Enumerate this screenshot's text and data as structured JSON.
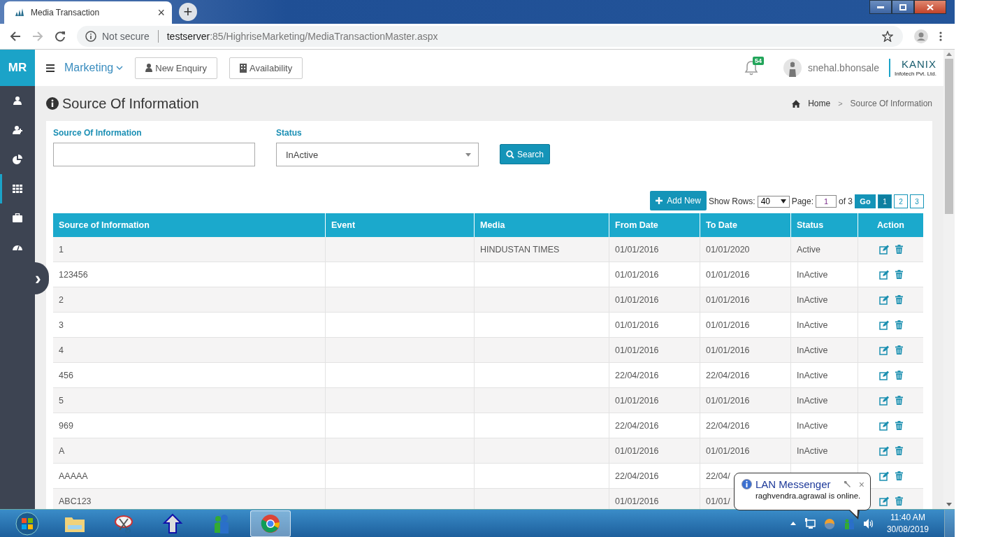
{
  "browser": {
    "tab_title": "Media Transaction",
    "tab_close": "×",
    "new_tab": "+",
    "security": "Not secure",
    "url_host": "testserver",
    "url_path": ":85/HighriseMarketing/MediaTransactionMaster.aspx"
  },
  "sidebar": {
    "logo": "MR",
    "toggle": "›",
    "items": [
      {
        "kind": "user",
        "selected": false
      },
      {
        "kind": "user-plus",
        "selected": false
      },
      {
        "kind": "pie",
        "selected": false
      },
      {
        "kind": "grid",
        "selected": true
      },
      {
        "kind": "briefcase",
        "selected": false
      },
      {
        "kind": "gauge",
        "selected": false
      }
    ]
  },
  "header": {
    "module": "Marketing",
    "buttons": [
      {
        "kind": "user",
        "label": "New Enquiry"
      },
      {
        "kind": "building",
        "label": "Availability"
      }
    ],
    "notifications": "54",
    "user": "snehal.bhonsale",
    "company": "KANIX",
    "company_sub": "Infotech Pvt. Ltd."
  },
  "page": {
    "title": "Source Of Information",
    "breadcrumb": [
      "Home",
      "Source Of Information"
    ],
    "breadcrumb_separator": ">"
  },
  "filters": {
    "source_label": "Source Of Information",
    "status_label": "Status",
    "status_value": "InActive",
    "search_button": "Search"
  },
  "toolbar": {
    "add_button": "Add New",
    "rows_label": "Show Rows:",
    "rows_value": "40",
    "page_label": "Page:",
    "page_value": "1",
    "of_label": "of 3",
    "go_button": "Go",
    "pages": [
      {
        "label": "1",
        "selected": true
      },
      {
        "label": "2",
        "selected": false
      },
      {
        "label": "3",
        "selected": false
      }
    ]
  },
  "table": {
    "columns": [
      "Source of Information",
      "Event",
      "Media",
      "From Date",
      "To Date",
      "Status",
      "Action"
    ],
    "rows": [
      {
        "source": "1",
        "media": "HINDUSTAN TIMES",
        "from_date": "01/01/2016",
        "to_date": "01/01/2020",
        "status": "Active"
      },
      {
        "source": "123456",
        "from_date": "01/01/2016",
        "to_date": "01/01/2016",
        "status": "InActive"
      },
      {
        "source": "2",
        "from_date": "01/01/2016",
        "to_date": "01/01/2016",
        "status": "InActive"
      },
      {
        "source": "3",
        "from_date": "01/01/2016",
        "to_date": "01/01/2016",
        "status": "InActive"
      },
      {
        "source": "4",
        "from_date": "01/01/2016",
        "to_date": "01/01/2016",
        "status": "InActive"
      },
      {
        "source": "456",
        "from_date": "22/04/2016",
        "to_date": "22/04/2016",
        "status": "InActive"
      },
      {
        "source": "5",
        "from_date": "01/01/2016",
        "to_date": "01/01/2016",
        "status": "InActive"
      },
      {
        "source": "969",
        "from_date": "22/04/2016",
        "to_date": "22/04/2016",
        "status": "InActive"
      },
      {
        "source": "A",
        "from_date": "01/01/2016",
        "to_date": "01/01/2016",
        "status": "InActive"
      },
      {
        "source": "AAAAA",
        "from_date": "22/04/2016",
        "to_date": "22/04/"
      },
      {
        "source": "ABC123",
        "from_date": "01/01/2016",
        "to_date": "01/01/"
      }
    ]
  },
  "popup": {
    "title": "LAN Messenger",
    "message": "raghvendra.agrawal is online.",
    "close": "×"
  },
  "taskbar": {
    "apps": [
      {
        "kind": "folder",
        "selected": false
      },
      {
        "kind": "scissors",
        "selected": false
      },
      {
        "kind": "arrow",
        "selected": false
      },
      {
        "kind": "messenger",
        "selected": false
      },
      {
        "kind": "chrome",
        "selected": true
      }
    ],
    "time": "11:40 AM",
    "date": "30/08/2019"
  }
}
